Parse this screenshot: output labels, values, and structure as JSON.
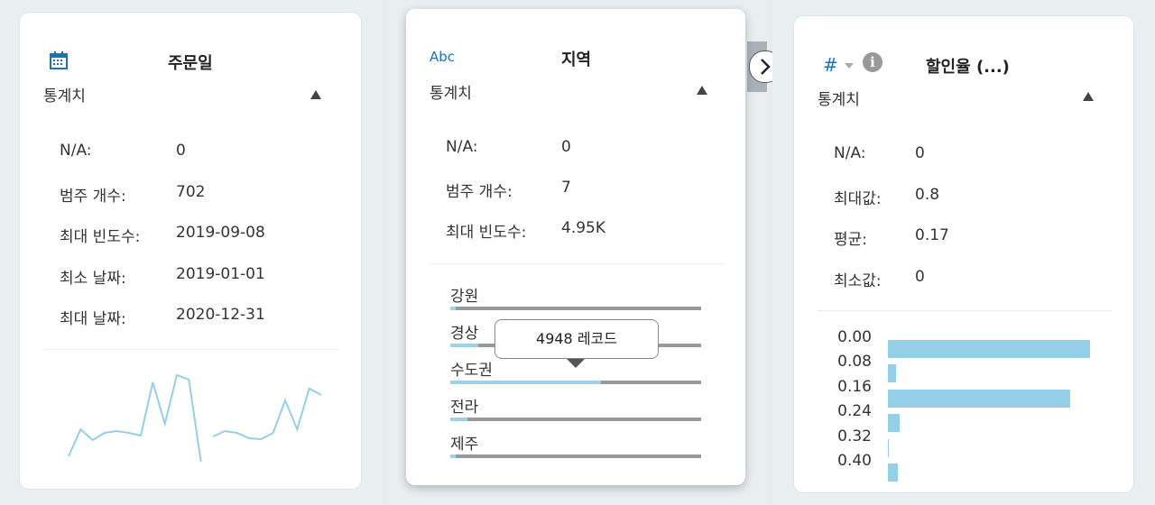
{
  "colors": {
    "accent": "#1a73b5",
    "bar": "#95cfe7",
    "track": "#999999",
    "background": "#e9eef1"
  },
  "card1": {
    "icon": "calendar-icon",
    "title": "주문일",
    "section": "통계치",
    "stats": [
      {
        "label": "N/A:",
        "value": "0"
      },
      {
        "label": "범주 개수:",
        "value": "702"
      },
      {
        "label": "최대 빈도수:",
        "value": "2019-09-08"
      },
      {
        "label": "최소 날짜:",
        "value": "2019-01-01"
      },
      {
        "label": "최대 날짜:",
        "value": "2020-12-31"
      }
    ],
    "sparkline": [
      0.1,
      0.4,
      0.28,
      0.36,
      0.38,
      0.36,
      0.33,
      0.92,
      0.46,
      1.0,
      0.95,
      0.04,
      0.32,
      0.38,
      0.36,
      0.3,
      0.29,
      0.36,
      0.72,
      0.4,
      0.85,
      0.78
    ]
  },
  "card2": {
    "icon_label": "Abc",
    "title": "지역",
    "section": "통계치",
    "stats": [
      {
        "label": "N/A:",
        "value": "0"
      },
      {
        "label": "범주 개수:",
        "value": "7"
      },
      {
        "label": "최대 빈도수:",
        "value": "4.95K"
      }
    ],
    "categories": [
      {
        "label": "강원",
        "fraction": 0.02
      },
      {
        "label": "경상",
        "fraction": 0.11
      },
      {
        "label": "수도권",
        "fraction": 0.6
      },
      {
        "label": "전라",
        "fraction": 0.07
      },
      {
        "label": "제주",
        "fraction": 0.02
      }
    ],
    "tooltip": "4948 레코드"
  },
  "card3": {
    "icon_label": "#",
    "title": "할인율 (...)",
    "section": "통계치",
    "stats": [
      {
        "label": "N/A:",
        "value": "0"
      },
      {
        "label": "최대값:",
        "value": "0.8"
      },
      {
        "label": "평균:",
        "value": "0.17"
      },
      {
        "label": "최소값:",
        "value": "0"
      }
    ]
  },
  "chart_data": {
    "type": "bar",
    "categories": [
      "0.00",
      "0.08",
      "0.16",
      "0.24",
      "0.32",
      "0.40"
    ],
    "values": [
      1.0,
      0.04,
      0.9,
      0.06,
      0.005,
      0.05
    ]
  }
}
